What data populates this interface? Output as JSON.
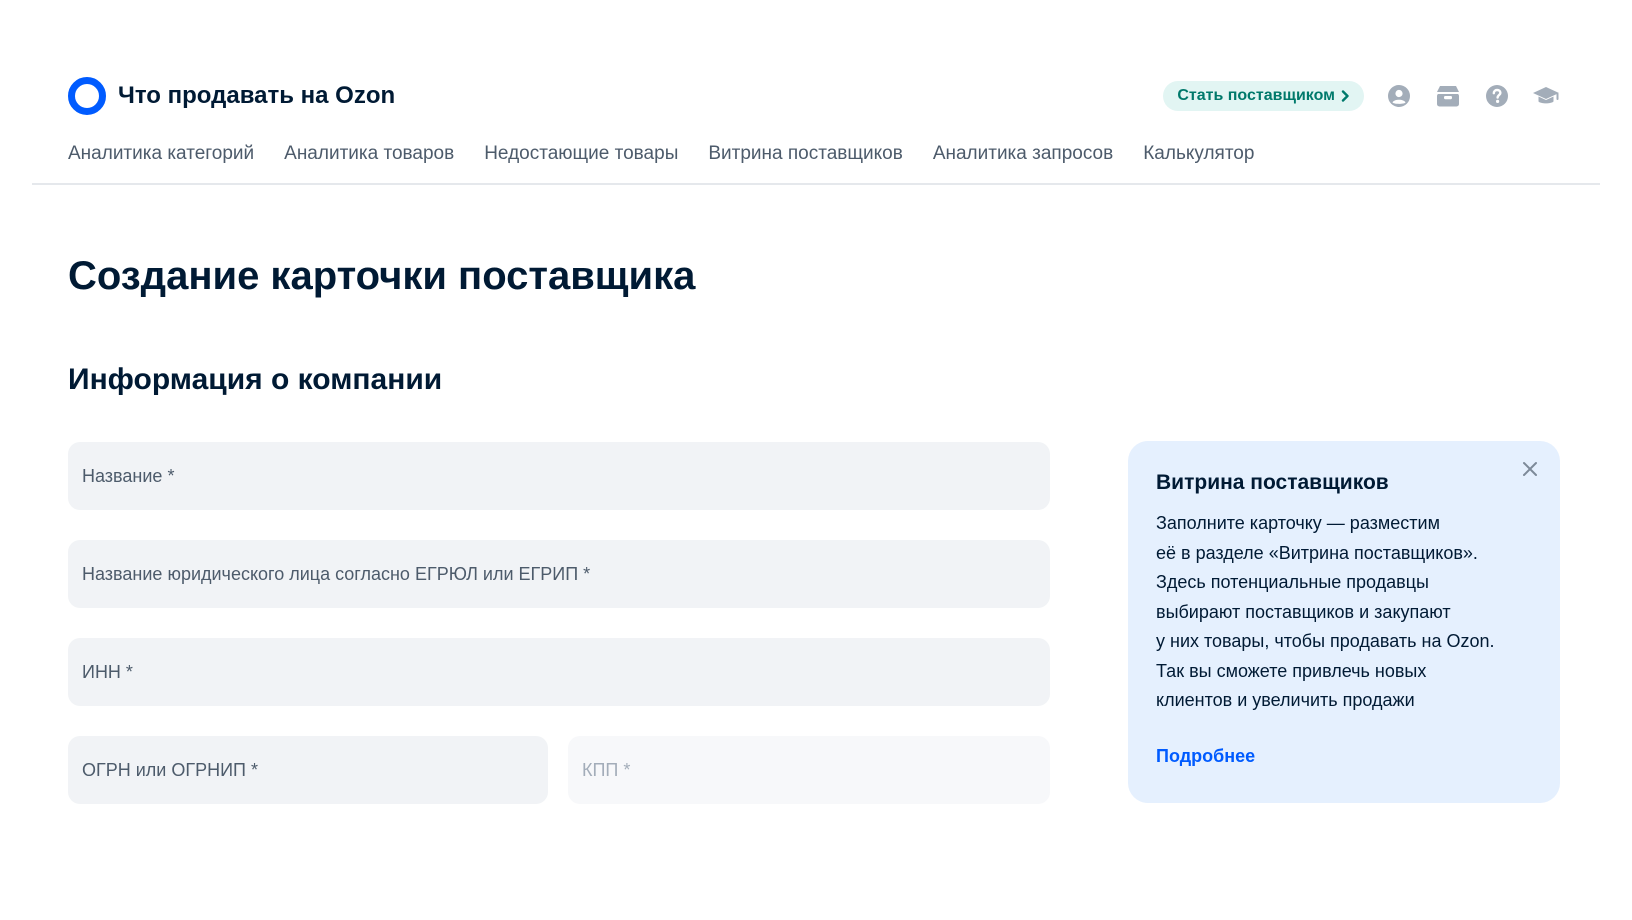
{
  "header": {
    "logo_text": "Что продавать на Ozon",
    "become_supplier_label": "Стать поставщиком",
    "icons": [
      "profile-icon",
      "box-icon",
      "help-icon",
      "education-icon"
    ]
  },
  "nav": {
    "items": [
      "Аналитика категорий",
      "Аналитика товаров",
      "Недостающие товары",
      "Витрина поставщиков",
      "Аналитика запросов",
      "Калькулятор"
    ]
  },
  "main": {
    "page_title": "Создание карточки поставщика",
    "section_title": "Информация о компании",
    "fields": {
      "name": "Название *",
      "legal_name": "Название юридического лица согласно ЕГРЮЛ или ЕГРИП *",
      "inn": "ИНН *",
      "ogrn": "ОГРН или ОГРНИП *",
      "kpp": "КПП *"
    }
  },
  "info_card": {
    "title": "Витрина поставщиков",
    "lines": [
      "Заполните карточку — разместим",
      "её в разделе «Витрина поставщиков».",
      "Здесь потенциальные продавцы",
      "выбирают поставщиков и закупают",
      "у них товары, чтобы продавать на Ozon.",
      "Так вы сможете привлечь новых",
      "клиентов и увеличить продажи"
    ],
    "link": "Подробнее"
  },
  "colors": {
    "brand": "#005bff",
    "supplier_badge_bg": "#e2f5f3",
    "supplier_badge_text": "#00796b",
    "field_bg": "#f1f3f6",
    "card_bg": "#e5f0fe",
    "icon": "#a3adb9"
  }
}
